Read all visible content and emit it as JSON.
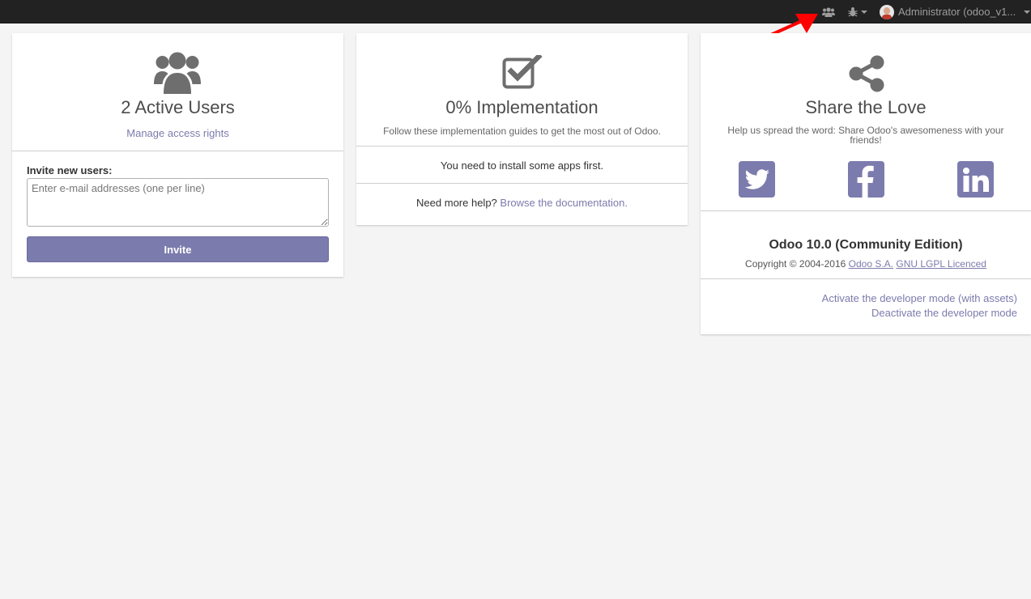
{
  "topbar": {
    "user_name": "Administrator (odoo_v1...",
    "icons": [
      "users-icon",
      "bug-icon",
      "caret-down-icon",
      "avatar"
    ]
  },
  "users_panel": {
    "title": "2 Active Users",
    "manage_link": "Manage access rights",
    "invite_label": "Invite new users:",
    "invite_placeholder": "Enter e-mail addresses (one per line)",
    "invite_value": "",
    "invite_button": "Invite"
  },
  "implementation_panel": {
    "title": "0% Implementation",
    "subtitle": "Follow these implementation guides to get the most out of Odoo.",
    "apps_notice": "You need to install some apps first.",
    "help_prefix": "Need more help?",
    "help_link": "Browse the documentation."
  },
  "share_panel": {
    "title": "Share the Love",
    "subtitle": "Help us spread the word: Share Odoo's awesomeness with your friends!",
    "social": [
      "twitter",
      "facebook",
      "linkedin"
    ],
    "version": "Odoo 10.0 (Community Edition)",
    "copyright_prefix": "Copyright © 2004-2016",
    "company_link": "Odoo S.A.",
    "license_link": "GNU LGPL Licenced",
    "dev_mode_assets": "Activate the developer mode (with assets)",
    "dev_mode_deactivate": "Deactivate the developer mode"
  },
  "colors": {
    "accent": "#7c7bad",
    "topbar": "#222222",
    "annotation_arrow": "#ff0000",
    "icon_gray": "#6e6e6e"
  }
}
